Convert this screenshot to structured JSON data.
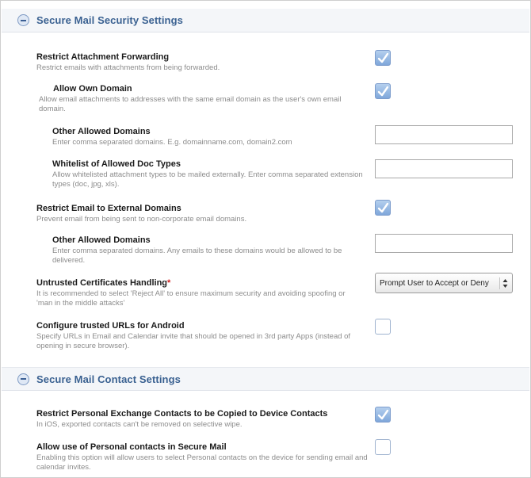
{
  "security_section": {
    "title": "Secure Mail Security Settings",
    "settings": [
      {
        "label": "Restrict Attachment Forwarding",
        "description": "Restrict emails with attachments from being forwarded.",
        "control": "checkbox",
        "checked": true
      },
      {
        "label": "Allow Own Domain",
        "description": "Allow email attachments to addresses with the same email domain as the user's own email domain.",
        "control": "checkbox",
        "checked": true
      },
      {
        "label": "Other Allowed Domains",
        "description": "Enter comma separated domains. E.g. domainname.com, domain2.com",
        "control": "text",
        "value": ""
      },
      {
        "label": "Whitelist of Allowed Doc Types",
        "description": "Allow whitelisted attachment types to be mailed externally. Enter comma separated extension types (doc, jpg, xls).",
        "control": "text",
        "value": ""
      },
      {
        "label": "Restrict Email to External Domains",
        "description": "Prevent email from being sent to non-corporate email domains.",
        "control": "checkbox",
        "checked": true
      },
      {
        "label": "Other Allowed Domains",
        "description": "Enter comma separated domains. Any emails to these domains would be allowed to be delivered.",
        "control": "text",
        "value": ""
      },
      {
        "label": "Untrusted Certificates Handling",
        "required_mark": "*",
        "description": "It is recommended to select 'Reject All' to ensure maximum security and avoiding spoofing or 'man in the middle attacks'",
        "control": "select",
        "selected": "Prompt User to Accept or Deny"
      },
      {
        "label": "Configure trusted URLs for Android",
        "description": "Specify URLs in Email and Calendar invite that should be opened in 3rd party Apps (instead of opening in secure browser).",
        "control": "checkbox",
        "checked": false
      }
    ]
  },
  "contact_section": {
    "title": "Secure Mail Contact Settings",
    "settings": [
      {
        "label": "Restrict Personal Exchange Contacts to be Copied to Device Contacts",
        "description": "In iOS, exported contacts can't be removed on selective wipe.",
        "control": "checkbox",
        "checked": true
      },
      {
        "label": "Allow use of Personal contacts in Secure Mail",
        "description": "Enabling this option will allow users to select Personal contacts on the device for sending email and calendar invites.",
        "control": "checkbox",
        "checked": false
      }
    ]
  },
  "icons": {
    "collapse": "minus-circle-icon",
    "check": "checkmark-icon",
    "select_arrows": "updown-arrows-icon"
  },
  "colors": {
    "section_title": "#3a6191",
    "checkbox_checked": "#7fa7da",
    "required_mark": "#d02020"
  }
}
